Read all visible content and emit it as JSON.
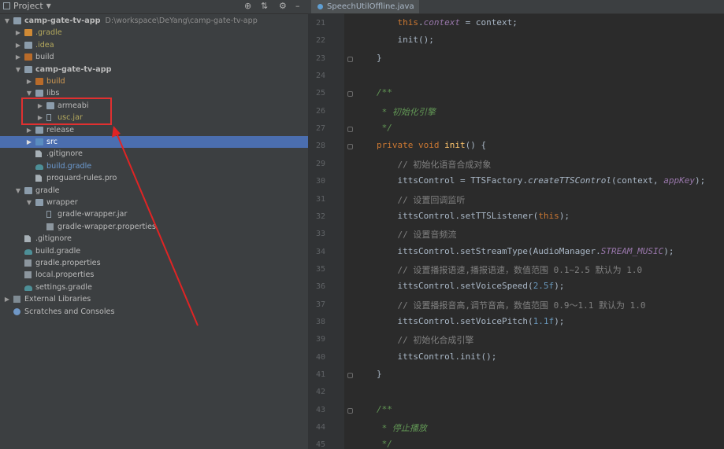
{
  "project_panel": {
    "title": "Project",
    "tree": [
      {
        "label": "camp-gate-tv-app",
        "path": "D:\\workspace\\DeYang\\camp-gate-tv-app",
        "depth": 0,
        "arrow": "down",
        "icon": "module-folder",
        "style": "bold"
      },
      {
        "label": ".gradle",
        "depth": 1,
        "arrow": "right",
        "icon": "orange-folder",
        "style": "olive"
      },
      {
        "label": ".idea",
        "depth": 1,
        "arrow": "right",
        "icon": "folder",
        "style": "olive"
      },
      {
        "label": "build",
        "depth": 1,
        "arrow": "right",
        "icon": "excluded-folder",
        "style": "normal"
      },
      {
        "label": "camp-gate-tv-app",
        "depth": 1,
        "arrow": "down",
        "icon": "module-folder",
        "style": "bold"
      },
      {
        "label": "build",
        "depth": 2,
        "arrow": "right",
        "icon": "excluded-folder",
        "style": "orange"
      },
      {
        "label": "libs",
        "depth": 2,
        "arrow": "down",
        "icon": "folder",
        "style": "normal"
      },
      {
        "label": "armeabi",
        "depth": 3,
        "arrow": "right",
        "icon": "folder",
        "style": "normal"
      },
      {
        "label": "usc.jar",
        "depth": 3,
        "arrow": "right",
        "icon": "jar",
        "style": "olive"
      },
      {
        "label": "release",
        "depth": 2,
        "arrow": "right",
        "icon": "folder",
        "style": "normal"
      },
      {
        "label": "src",
        "depth": 2,
        "arrow": "right",
        "icon": "source-folder",
        "style": "selected"
      },
      {
        "label": ".gitignore",
        "depth": 2,
        "arrow": "",
        "icon": "file",
        "style": "normal"
      },
      {
        "label": "build.gradle",
        "depth": 2,
        "arrow": "",
        "icon": "gradle",
        "style": "blue"
      },
      {
        "label": "proguard-rules.pro",
        "depth": 2,
        "arrow": "",
        "icon": "file",
        "style": "normal"
      },
      {
        "label": "gradle",
        "depth": 1,
        "arrow": "down",
        "icon": "folder",
        "style": "normal"
      },
      {
        "label": "wrapper",
        "depth": 2,
        "arrow": "down",
        "icon": "folder",
        "style": "normal"
      },
      {
        "label": "gradle-wrapper.jar",
        "depth": 3,
        "arrow": "",
        "icon": "jar",
        "style": "normal"
      },
      {
        "label": "gradle-wrapper.properties",
        "depth": 3,
        "arrow": "",
        "icon": "properties",
        "style": "normal"
      },
      {
        "label": ".gitignore",
        "depth": 1,
        "arrow": "",
        "icon": "file",
        "style": "normal"
      },
      {
        "label": "build.gradle",
        "depth": 1,
        "arrow": "",
        "icon": "gradle",
        "style": "normal"
      },
      {
        "label": "gradle.properties",
        "depth": 1,
        "arrow": "",
        "icon": "properties",
        "style": "normal"
      },
      {
        "label": "local.properties",
        "depth": 1,
        "arrow": "",
        "icon": "properties",
        "style": "normal"
      },
      {
        "label": "settings.gradle",
        "depth": 1,
        "arrow": "",
        "icon": "gradle",
        "style": "normal"
      },
      {
        "label": "External Libraries",
        "depth": 0,
        "arrow": "right",
        "icon": "external-libraries",
        "style": "normal"
      },
      {
        "label": "Scratches and Consoles",
        "depth": 0,
        "arrow": "",
        "icon": "scratch",
        "style": "normal"
      }
    ]
  },
  "editor": {
    "tab_label": "SpeechUtilOffline.java",
    "lines": [
      {
        "n": "21",
        "t": [
          [
            "par",
            "    "
          ],
          [
            "kw",
            "this"
          ],
          [
            "par",
            "."
          ],
          [
            "fld",
            "context"
          ],
          [
            "par",
            " = context;"
          ]
        ]
      },
      {
        "n": "22",
        "t": [
          [
            "par",
            "    init();"
          ]
        ]
      },
      {
        "n": "23",
        "t": [
          [
            "par",
            "}"
          ]
        ]
      },
      {
        "n": "24",
        "t": []
      },
      {
        "n": "25",
        "t": [
          [
            "doc",
            "/**"
          ]
        ]
      },
      {
        "n": "26",
        "t": [
          [
            "doc",
            " * 初始化引擎"
          ]
        ]
      },
      {
        "n": "27",
        "t": [
          [
            "doc",
            " */"
          ]
        ]
      },
      {
        "n": "28",
        "t": [
          [
            "kw",
            "private void "
          ],
          [
            "fn",
            "init"
          ],
          [
            "par",
            "() {"
          ]
        ]
      },
      {
        "n": "29",
        "t": [
          [
            "par",
            "    "
          ],
          [
            "cm",
            "// 初始化语音合成对象"
          ]
        ]
      },
      {
        "n": "30",
        "t": [
          [
            "par",
            "    ittsControl = TTSFactory."
          ],
          [
            "it",
            "createTTSControl"
          ],
          [
            "par",
            "(context, "
          ],
          [
            "fld",
            "appKey"
          ],
          [
            "par",
            ");"
          ]
        ]
      },
      {
        "n": "31",
        "t": [
          [
            "par",
            "    "
          ],
          [
            "cm",
            "// 设置回调监听"
          ]
        ]
      },
      {
        "n": "32",
        "t": [
          [
            "par",
            "    ittsControl.setTTSListener("
          ],
          [
            "kw",
            "this"
          ],
          [
            "par",
            ");"
          ]
        ]
      },
      {
        "n": "33",
        "t": [
          [
            "par",
            "    "
          ],
          [
            "cm",
            "// 设置音频流"
          ]
        ]
      },
      {
        "n": "34",
        "t": [
          [
            "par",
            "    ittsControl.setStreamType(AudioManager."
          ],
          [
            "fld",
            "STREAM_MUSIC"
          ],
          [
            "par",
            ");"
          ]
        ]
      },
      {
        "n": "35",
        "t": [
          [
            "par",
            "    "
          ],
          [
            "cm",
            "// 设置播报语速,播报语速，数值范围 0.1~2.5 默认为 1.0"
          ]
        ]
      },
      {
        "n": "36",
        "t": [
          [
            "par",
            "    ittsControl.setVoiceSpeed("
          ],
          [
            "num",
            "2.5f"
          ],
          [
            "par",
            ");"
          ]
        ]
      },
      {
        "n": "37",
        "t": [
          [
            "par",
            "    "
          ],
          [
            "cm",
            "// 设置播报音高,调节音高，数值范围 0.9～1.1 默认为 1.0"
          ]
        ]
      },
      {
        "n": "38",
        "t": [
          [
            "par",
            "    ittsControl.setVoicePitch("
          ],
          [
            "num",
            "1.1f"
          ],
          [
            "par",
            ");"
          ]
        ]
      },
      {
        "n": "39",
        "t": [
          [
            "par",
            "    "
          ],
          [
            "cm",
            "// 初始化合成引擎"
          ]
        ]
      },
      {
        "n": "40",
        "t": [
          [
            "par",
            "    ittsControl.init();"
          ]
        ]
      },
      {
        "n": "41",
        "t": [
          [
            "par",
            "}"
          ]
        ]
      },
      {
        "n": "42",
        "t": []
      },
      {
        "n": "43",
        "t": [
          [
            "doc",
            "/**"
          ]
        ]
      },
      {
        "n": "44",
        "t": [
          [
            "doc",
            " * 停止播放"
          ]
        ]
      },
      {
        "n": "45",
        "t": [
          [
            "doc",
            " */"
          ]
        ]
      }
    ]
  },
  "colors": {
    "selection": "#4b6eaf",
    "highlight_box": "#e03030",
    "editor_bg": "#2b2b2b",
    "panel_bg": "#3c3f41"
  }
}
